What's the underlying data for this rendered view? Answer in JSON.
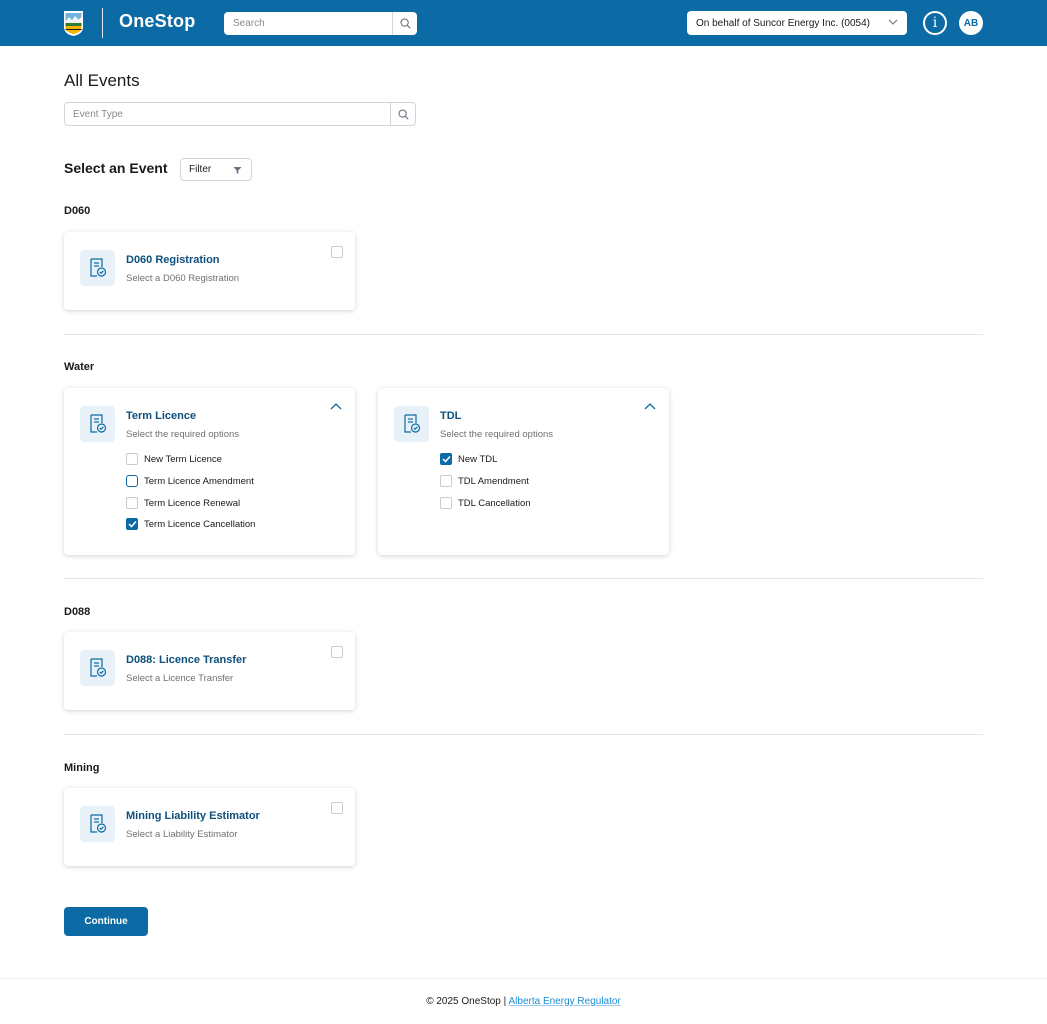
{
  "header": {
    "brand": "OneStop",
    "search_placeholder": "Search",
    "org_selector": "On behalf of Suncor Energy Inc. (0054)",
    "avatar_initials": "AB",
    "info_glyph": "i",
    "bg_color": "#0c6ba5"
  },
  "page": {
    "title": "All Events",
    "event_type_placeholder": "Event Type",
    "select_title": "Select an Event",
    "filter_label": "Filter"
  },
  "sections": {
    "d060": {
      "title": "D060",
      "cards": [
        {
          "title": "D060 Registration",
          "subtitle": "Select a D060 Registration",
          "checked": false
        }
      ]
    },
    "water": {
      "title": "Water",
      "cards": [
        {
          "title": "Term Licence",
          "subtitle": "Select the required options",
          "expanded": true,
          "options": [
            {
              "label": "New Term Licence",
              "checked": false
            },
            {
              "label": "Term Licence Amendment",
              "checked": false,
              "focused": true
            },
            {
              "label": "Term Licence Renewal",
              "checked": false
            },
            {
              "label": "Term Licence Cancellation",
              "checked": true
            }
          ]
        },
        {
          "title": "TDL",
          "subtitle": "Select the required options",
          "expanded": true,
          "options": [
            {
              "label": "New TDL",
              "checked": true
            },
            {
              "label": "TDL Amendment",
              "checked": false
            },
            {
              "label": "TDL Cancellation",
              "checked": false
            }
          ]
        }
      ]
    },
    "d088": {
      "title": "D088",
      "cards": [
        {
          "title": "D088: Licence Transfer",
          "subtitle": "Select a Licence Transfer",
          "checked": false
        }
      ]
    },
    "mining": {
      "title": "Mining",
      "cards": [
        {
          "title": "Mining Liability Estimator",
          "subtitle": "Select a Liability Estimator",
          "checked": false
        }
      ]
    }
  },
  "actions": {
    "continue_label": "Continue"
  },
  "footer": {
    "copyright": "© 2025 OneStop |",
    "link_text": "Alberta Energy Regulator"
  },
  "icons": {
    "logo": "alberta-shield-logo",
    "search": "search-icon",
    "dropdown": "chevron-down-icon",
    "filter": "filter-icon",
    "card": "document-check-icon",
    "collapse": "chevron-up-icon",
    "info": "info-icon"
  }
}
